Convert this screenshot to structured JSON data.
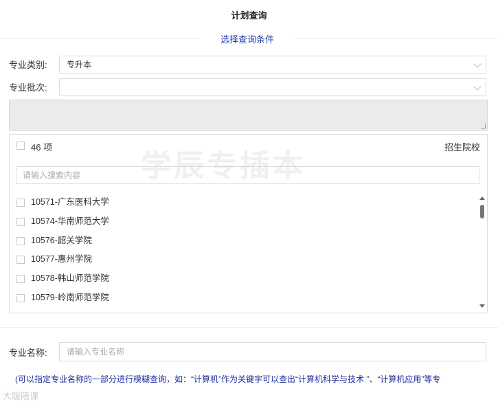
{
  "header": {
    "title": "计划查询"
  },
  "section": {
    "title": "选择查询条件"
  },
  "form": {
    "major_type_label": "专业类别:",
    "major_type_value": "专升本",
    "major_batch_label": "专业批次:",
    "major_batch_value": "",
    "major_name_label": "专业名称:",
    "major_name_placeholder": "请输入专业名称"
  },
  "school_panel": {
    "count_label": "46 项",
    "header_right": "招生院校",
    "search_placeholder": "请输入搜索内容",
    "items": [
      {
        "label": "10571-广东医科大学"
      },
      {
        "label": "10574-华南师范大学"
      },
      {
        "label": "10576-韶关学院"
      },
      {
        "label": "10577-惠州学院"
      },
      {
        "label": "10578-韩山师范学院"
      },
      {
        "label": "10579-岭南师范学院"
      }
    ]
  },
  "watermark": "学辰专插本",
  "hint": "(可以指定专业名称的一部分进行模糊查询，如：“计算机”作为关键字可以查出“计算机科学与技术 ”、“计算机应用”等专",
  "logo": "大跋陪课",
  "colors": {
    "accent": "#1f3fa8",
    "hint": "#1e2f9f"
  }
}
